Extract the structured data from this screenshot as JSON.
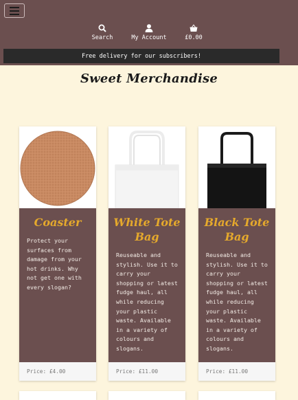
{
  "header": {
    "menu_icon": "hamburger-icon",
    "nav": [
      {
        "label": "Search",
        "icon": "search-icon"
      },
      {
        "label": "My Account",
        "icon": "user-icon"
      },
      {
        "label": "£0.00",
        "icon": "basket-icon"
      }
    ],
    "delivery_banner": "Free delivery for our subscribers!"
  },
  "main": {
    "title": "Sweet Merchandise",
    "products": [
      {
        "name": "Coaster",
        "description": "Protect your\nsurfaces from\ndamage from your\nhot drinks. Why\nnot get one with\nevery slogan?",
        "price": "Price: £4.00"
      },
      {
        "name": "White Tote\nBag",
        "description": "Reuseable and\nstylish. Use it to\ncarry your\nshopping or latest\nfudge haul, all\nwhile reducing\nyour plastic\nwaste. Available\nin a variety of\ncolours and\nslogans.",
        "price": "Price: £11.00"
      },
      {
        "name": "Black Tote\nBag",
        "description": "Reuseable and\nstylish. Use it to\ncarry your\nshopping or latest\nfudge haul, all\nwhile reducing\nyour plastic\nwaste. Available\nin a variety of\ncolours and\nslogans.",
        "price": "Price: £11.00"
      }
    ]
  },
  "colors": {
    "header_bg": "#6b4f4f",
    "page_bg": "#fdf5dd",
    "accent": "#e5a92c",
    "banner_bg": "#2a2a2a"
  }
}
